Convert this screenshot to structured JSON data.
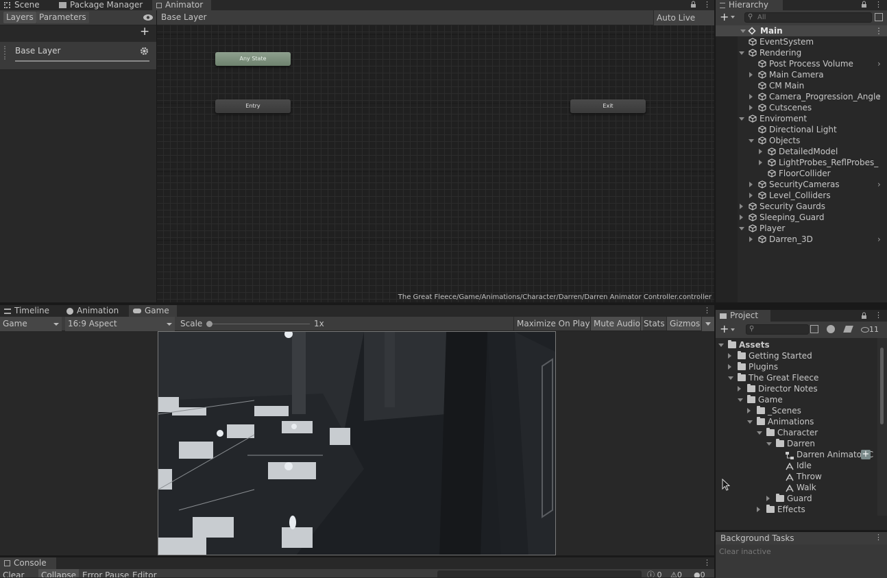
{
  "topTabs": {
    "scene": "Scene",
    "packageManager": "Package Manager",
    "animator": "Animator",
    "hierarchy": "Hierarchy"
  },
  "animator": {
    "layersTab": "Layers",
    "parametersTab": "Parameters",
    "breadcrumb": "Base Layer",
    "autoLiveLink": "Auto Live Link",
    "layerName": "Base Layer",
    "nodes": {
      "anyState": "Any State",
      "entry": "Entry",
      "exit": "Exit"
    },
    "path": "The Great Fleece/Game/Animations/Character/Darren/Darren Animator Controller.controller"
  },
  "hierarchy": {
    "searchPlaceholder": "All",
    "scene": "Main",
    "items": [
      {
        "label": "EventSystem"
      },
      {
        "label": "Rendering"
      },
      {
        "label": "Post Process Volume"
      },
      {
        "label": "Main Camera"
      },
      {
        "label": "CM Main"
      },
      {
        "label": "Camera_Progression_Angle"
      },
      {
        "label": "Cutscenes"
      },
      {
        "label": "Enviroment"
      },
      {
        "label": "Directional Light"
      },
      {
        "label": "Objects"
      },
      {
        "label": "DetailedModel"
      },
      {
        "label": "LightProbes_ReflProbes_"
      },
      {
        "label": "FloorCollider"
      },
      {
        "label": "SecurityCameras"
      },
      {
        "label": "Level_Colliders"
      },
      {
        "label": "Security Gaurds"
      },
      {
        "label": "Sleeping_Guard"
      },
      {
        "label": "Player"
      },
      {
        "label": "Darren_3D"
      }
    ]
  },
  "bottomTabs": {
    "timeline": "Timeline",
    "animation": "Animation",
    "game": "Game"
  },
  "gameToolbar": {
    "display": "Game",
    "aspect": "16:9 Aspect",
    "scaleLabel": "Scale",
    "scaleValue": "1x",
    "maximize": "Maximize On Play",
    "mute": "Mute Audio",
    "stats": "Stats",
    "gizmos": "Gizmos"
  },
  "project": {
    "title": "Project",
    "hiddenCount": "11",
    "items": [
      {
        "label": "Assets"
      },
      {
        "label": "Getting Started"
      },
      {
        "label": "Plugins"
      },
      {
        "label": "The Great Fleece"
      },
      {
        "label": "Director Notes"
      },
      {
        "label": "Game"
      },
      {
        "label": "_Scenes"
      },
      {
        "label": "Animations"
      },
      {
        "label": "Character"
      },
      {
        "label": "Darren"
      },
      {
        "label": "Darren Animator C"
      },
      {
        "label": "Idle"
      },
      {
        "label": "Throw"
      },
      {
        "label": "Walk"
      },
      {
        "label": "Guard"
      },
      {
        "label": "Effects"
      }
    ]
  },
  "backgroundTasks": {
    "title": "Background Tasks",
    "clear": "Clear inactive"
  },
  "console": {
    "title": "Console",
    "clear": "Clear",
    "collapse": "Collapse",
    "errorPause": "Error Pause",
    "editor": "Editor",
    "counts": {
      "log": "0",
      "warn": "0",
      "error": "0"
    }
  }
}
